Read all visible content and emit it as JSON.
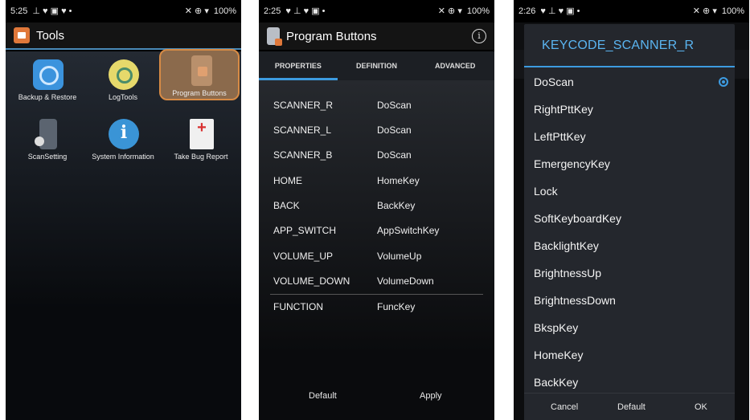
{
  "phone1": {
    "status": {
      "time": "5:25",
      "left_icons": "⊥ ♥ ▣ ♥ •",
      "right_icons": "✕ ⊕ ▾",
      "battery": "100%"
    },
    "title": "Tools",
    "apps": [
      {
        "label": "Backup & Restore",
        "icon": "backup-icon"
      },
      {
        "label": "LogTools",
        "icon": "log-icon"
      },
      {
        "label": "Program Buttons",
        "icon": "program-buttons-icon",
        "selected": true
      },
      {
        "label": "ScanSetting",
        "icon": "scan-setting-icon"
      },
      {
        "label": "System Information",
        "icon": "system-info-icon"
      },
      {
        "label": "Take Bug Report",
        "icon": "bug-report-icon"
      }
    ]
  },
  "phone2": {
    "status": {
      "time": "2:25",
      "left_icons": "♥ ⊥ ♥ ▣ •",
      "right_icons": "✕ ⊕ ▾",
      "battery": "100%"
    },
    "title": "Program Buttons",
    "tabs": [
      "PROPERTIES",
      "DEFINITION",
      "ADVANCED"
    ],
    "active_tab": "PROPERTIES",
    "rows": [
      {
        "key": "SCANNER_R",
        "value": "DoScan"
      },
      {
        "key": "SCANNER_L",
        "value": "DoScan"
      },
      {
        "key": "SCANNER_B",
        "value": "DoScan"
      },
      {
        "key": "HOME",
        "value": "HomeKey"
      },
      {
        "key": "BACK",
        "value": "BackKey"
      },
      {
        "key": "APP_SWITCH",
        "value": "AppSwitchKey"
      },
      {
        "key": "VOLUME_UP",
        "value": "VolumeUp"
      },
      {
        "key": "VOLUME_DOWN",
        "value": "VolumeDown"
      },
      {
        "key": "FUNCTION",
        "value": "FuncKey"
      }
    ],
    "buttons": {
      "default": "Default",
      "apply": "Apply"
    }
  },
  "phone3": {
    "status": {
      "time": "2:26",
      "left_icons": "♥ ⊥ ♥ ▣ •",
      "right_icons": "✕ ⊕ ▾",
      "battery": "100%"
    },
    "dialog_title": "KEYCODE_SCANNER_R",
    "options": [
      "DoScan",
      "RightPttKey",
      "LeftPttKey",
      "EmergencyKey",
      "Lock",
      "SoftKeyboardKey",
      "BacklightKey",
      "BrightnessUp",
      "BrightnessDown",
      "BkspKey",
      "HomeKey",
      "BackKey"
    ],
    "selected_option": "DoScan",
    "buttons": {
      "cancel": "Cancel",
      "default": "Default",
      "ok": "OK"
    }
  },
  "colors": {
    "accent": "#3d9be0",
    "selected_tile": "#8b6a4c",
    "selected_tile_border": "#d78b45",
    "dialog_title": "#5ab4f0"
  }
}
